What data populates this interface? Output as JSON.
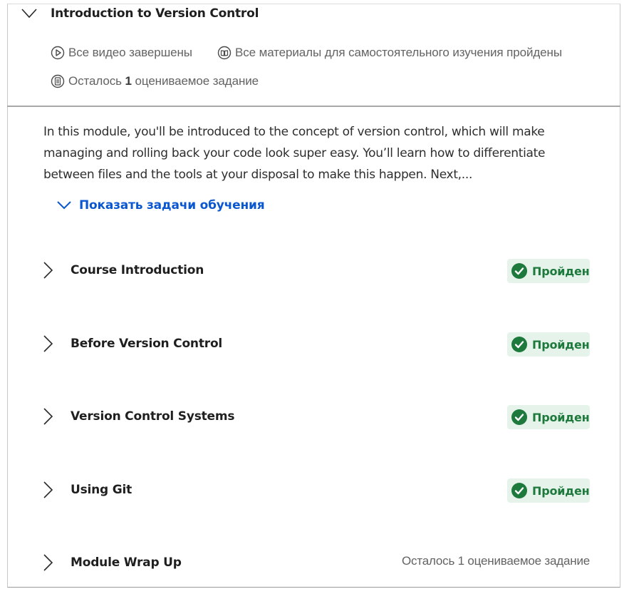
{
  "module": {
    "title": "Introduction to Version Control",
    "meta": {
      "videos": "Все видео завершены",
      "materials": "Все материалы для самостоятельного изучения пройдены",
      "remaining_prefix": "Осталось",
      "remaining_count": "1",
      "remaining_suffix": "оцениваемое задание"
    },
    "description": "In this module, you'll be introduced to the concept of version control, which will make managing and rolling back your code look super easy. You’ll learn how to differentiate between files and the tools at your disposal to make this happen. Next,...",
    "show_objectives_label": "Показать задачи обучения"
  },
  "lessons": [
    {
      "title": "Course Introduction",
      "status": "Пройден"
    },
    {
      "title": "Before Version Control",
      "status": "Пройден"
    },
    {
      "title": "Version Control Systems",
      "status": "Пройден"
    },
    {
      "title": "Using Git",
      "status": "Пройден"
    },
    {
      "title": "Module Wrap Up",
      "remaining": "Осталось 1 оцениваемое задание"
    }
  ],
  "colors": {
    "accent_link": "#0b57d0",
    "success_green": "#1e7a3c",
    "success_bg": "#e6f3ea"
  },
  "icons": {
    "collapse": "chevron-down-icon",
    "expand": "chevron-right-icon",
    "video": "play-circle-icon",
    "reading": "book-icon",
    "assignment": "document-list-icon",
    "completed": "check-circle-icon"
  }
}
